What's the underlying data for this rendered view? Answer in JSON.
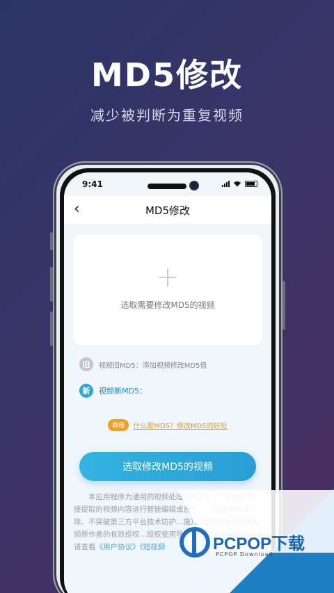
{
  "hero": {
    "title": "MD5修改",
    "subtitle": "减少被判断为重复视频"
  },
  "status_bar": {
    "time": "9:41"
  },
  "navbar": {
    "back_icon": "‹",
    "title": "MD5修改"
  },
  "upload": {
    "plus": "+",
    "text": "选取需要修改MD5的视频"
  },
  "md5_old": {
    "badge": "旧",
    "text": "视频旧MD5：添加视频修改MD5值"
  },
  "md5_new": {
    "badge": "新",
    "text": "视频新MD5："
  },
  "tutorial": {
    "badge": "教程",
    "link": "什么是MD5？修改MD5的好处"
  },
  "primary_button": "选取修改MD5的视频",
  "notice": {
    "text": "本应用程序为通用的视频处理技术平台，不对通过链接提取的视频内容进行智能编辑或自动…（包括水印消除、不突破第三方平台技术防护…施）。您须确保已取得视频原作者的有效授权…授权使用导致的侵权后果由用户…",
    "prefix": "请查看",
    "link1": "《用户协议》",
    "link2": "《短视频"
  },
  "watermark": {
    "brand": "PCPOP下载",
    "sub": "PCPOP Download"
  },
  "colors": {
    "accent": "#2ea6d8",
    "tutorial": "#f0a020"
  }
}
